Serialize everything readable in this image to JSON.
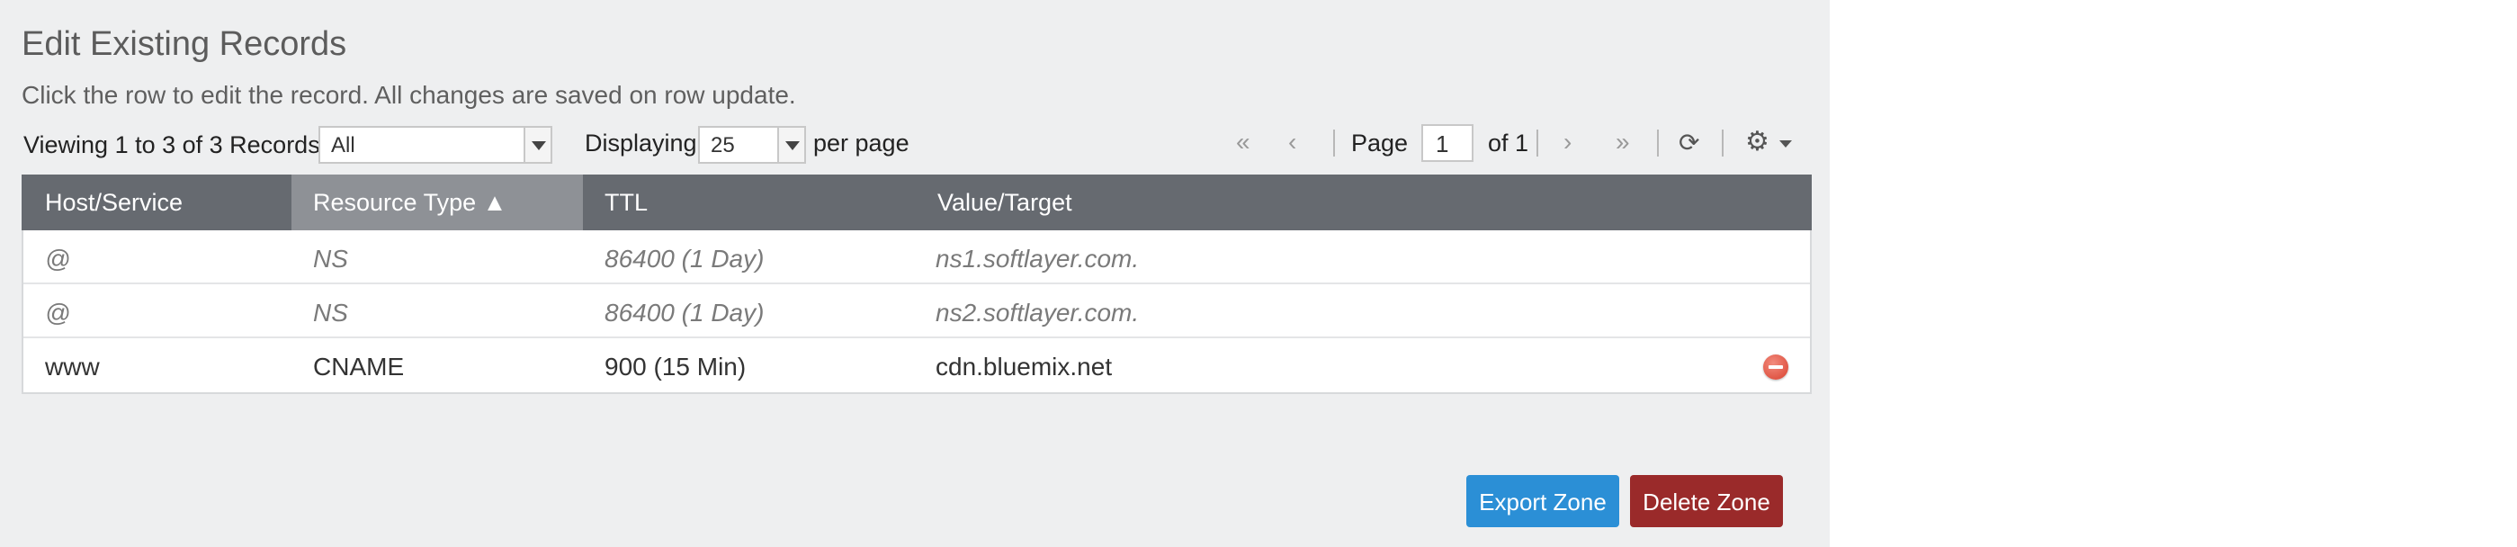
{
  "section": {
    "title": "Edit Existing Records",
    "subtitle": "Click the row to edit the record. All changes are saved on row update."
  },
  "toolbar": {
    "viewing_text": "Viewing 1 to 3 of 3 Records",
    "type_filter": "All",
    "displaying_label": "Displaying",
    "per_page_value": "25",
    "per_page_label": "per page",
    "first_glyph": "«",
    "prev_glyph": "‹",
    "next_glyph": "›",
    "last_glyph": "»",
    "page_label": "Page",
    "page_value": "1",
    "of_label": "of 1",
    "refresh_glyph": "⟳",
    "gear_glyph": "⚙"
  },
  "table": {
    "columns": [
      "Host/Service",
      "Resource Type ▲",
      "TTL",
      "Value/Target"
    ],
    "rows": [
      {
        "host": "@",
        "type": "NS",
        "ttl": "86400 (1 Day)",
        "value": "ns1.softlayer.com."
      },
      {
        "host": "@",
        "type": "NS",
        "ttl": "86400 (1 Day)",
        "value": "ns2.softlayer.com."
      },
      {
        "host": "www",
        "type": "CNAME",
        "ttl": "900 (15 Min)",
        "value": "cdn.bluemix.net"
      }
    ]
  },
  "actions": {
    "export_label": "Export Zone",
    "delete_label": "Delete Zone"
  },
  "colors": {
    "header_bg": "#666a70",
    "sorted_header_bg": "#8e9196",
    "export_button": "#2b8fd6",
    "delete_button": "#9a2a2a",
    "delete_icon": "#d9412f"
  },
  "icons": [
    "first-page-icon",
    "prev-page-icon",
    "next-page-icon",
    "last-page-icon",
    "refresh-icon",
    "gear-icon",
    "dropdown-caret-icon",
    "delete-record-icon"
  ]
}
